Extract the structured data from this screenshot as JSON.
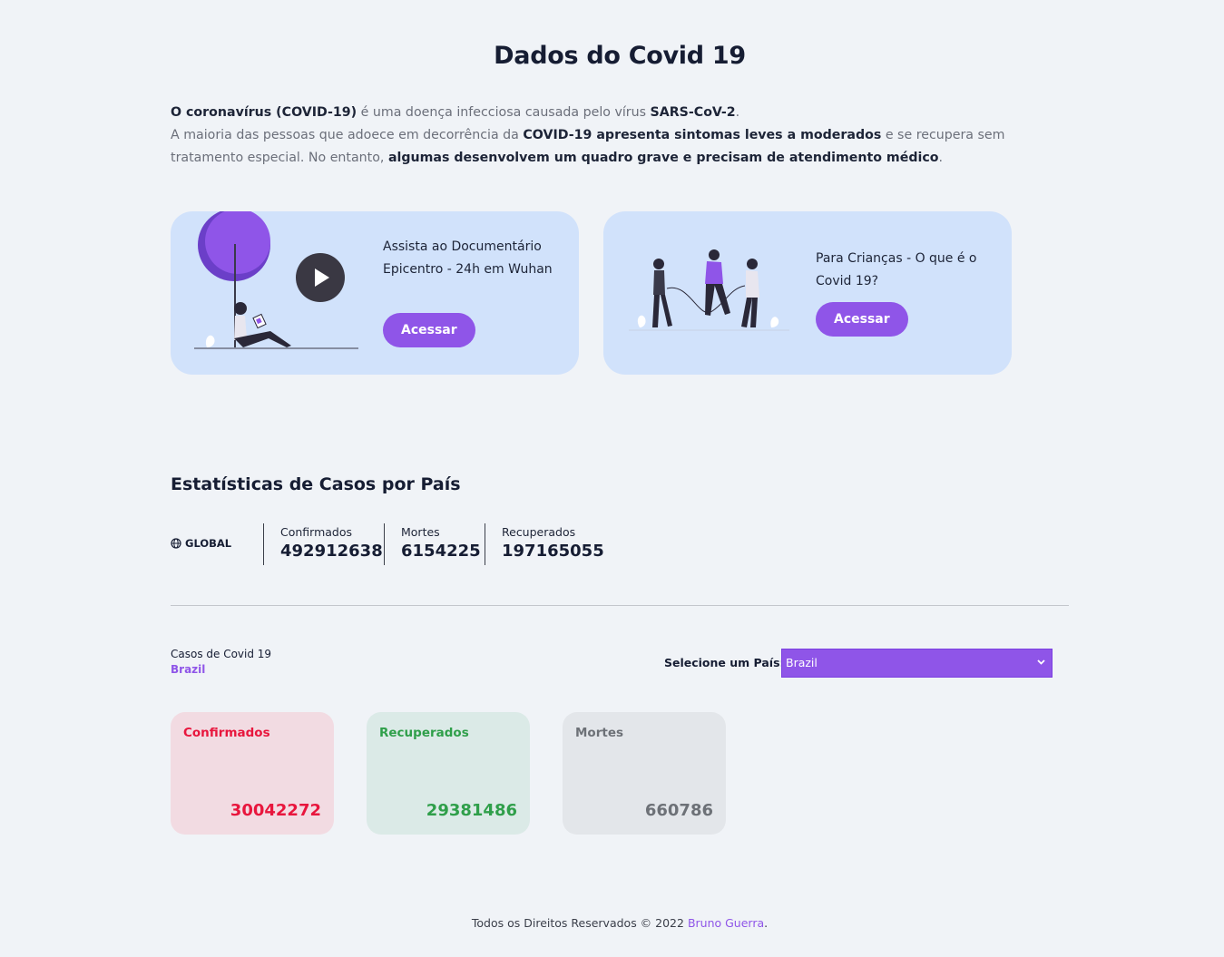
{
  "header": {
    "title": "Dados do Covid 19"
  },
  "intro": {
    "p1_b1": "O coronavírus (COVID-19)",
    "p1_t1": " é uma doença infecciosa causada pelo vírus ",
    "p1_b2": "SARS-CoV-2",
    "p1_t2": ".",
    "p2_t1": "A maioria das pessoas que adoece em decorrência da ",
    "p2_b1": "COVID-19 apresenta sintomas leves a moderados",
    "p2_t2": " e se recupera sem tratamento especial. No entanto, ",
    "p2_b2": "algumas desenvolvem um quadro grave e precisam de atendimento médico",
    "p2_t3": "."
  },
  "cards": [
    {
      "text": "Assista ao Documentário Epicentro - 24h em Wuhan",
      "button": "Acessar",
      "icon": "play-icon"
    },
    {
      "text": "Para Crianças - O que é o Covid 19?",
      "button": "Acessar"
    }
  ],
  "stats": {
    "title": "Estatísticas de Casos por País",
    "global_label": "GLOBAL",
    "global_icon": "globe-icon",
    "confirmed_label": "Confirmados",
    "confirmed_value": "492912638",
    "deaths_label": "Mortes",
    "deaths_value": "6154225",
    "recovered_label": "Recuperados",
    "recovered_value": "197165055"
  },
  "country": {
    "title": "Casos de Covid 19",
    "name": "Brazil",
    "select_label": "Selecione um País:",
    "selected": "Brazil",
    "confirmed_label": "Confirmados",
    "confirmed_value": "30042272",
    "recovered_label": "Recuperados",
    "recovered_value": "29381486",
    "deaths_label": "Mortes",
    "deaths_value": "660786"
  },
  "colors": {
    "accent": "#8f55e8",
    "card_bg": "#d1e2fb",
    "confirmed": "#e8163d",
    "recovered": "#2f9f4a",
    "deaths": "#6d7177"
  },
  "footer": {
    "text": "Todos os Direitos Reservados © 2022 ",
    "author": "Bruno Guerra",
    "end": "."
  }
}
